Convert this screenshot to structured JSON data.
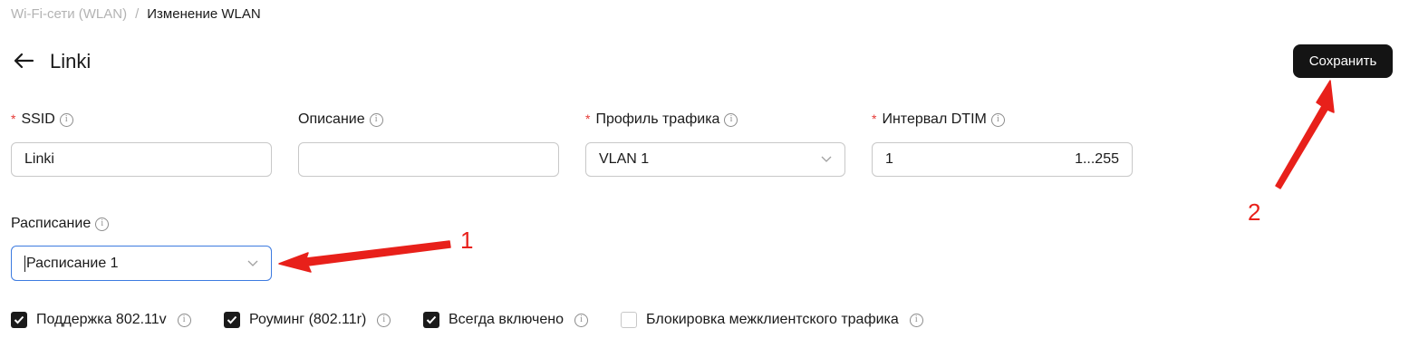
{
  "breadcrumb": {
    "parent": "Wi-Fi-сети (WLAN)",
    "separator": "/",
    "current": "Изменение WLAN"
  },
  "header": {
    "title": "Linki",
    "save_label": "Сохранить"
  },
  "fields": {
    "ssid": {
      "label": "SSID",
      "value": "Linki",
      "required": true
    },
    "description": {
      "label": "Описание",
      "value": ""
    },
    "traffic_profile": {
      "label": "Профиль трафика",
      "value": "VLAN 1",
      "required": true
    },
    "dtim": {
      "label": "Интервал DTIM",
      "value": "1",
      "range": "1...255",
      "required": true
    },
    "schedule": {
      "label": "Расписание",
      "value": "Расписание 1"
    }
  },
  "checkboxes": [
    {
      "label": "Поддержка 802.11v",
      "checked": true
    },
    {
      "label": "Роуминг (802.11r)",
      "checked": true
    },
    {
      "label": "Всегда включено",
      "checked": true
    },
    {
      "label": "Блокировка межклиентского трафика",
      "checked": false
    }
  ],
  "annotations": {
    "marker_1": "1",
    "marker_2": "2",
    "color": "#e8201a"
  },
  "colors": {
    "primary_button": "#141414",
    "required_star": "#e53935",
    "focus_border": "#3d7be0"
  }
}
